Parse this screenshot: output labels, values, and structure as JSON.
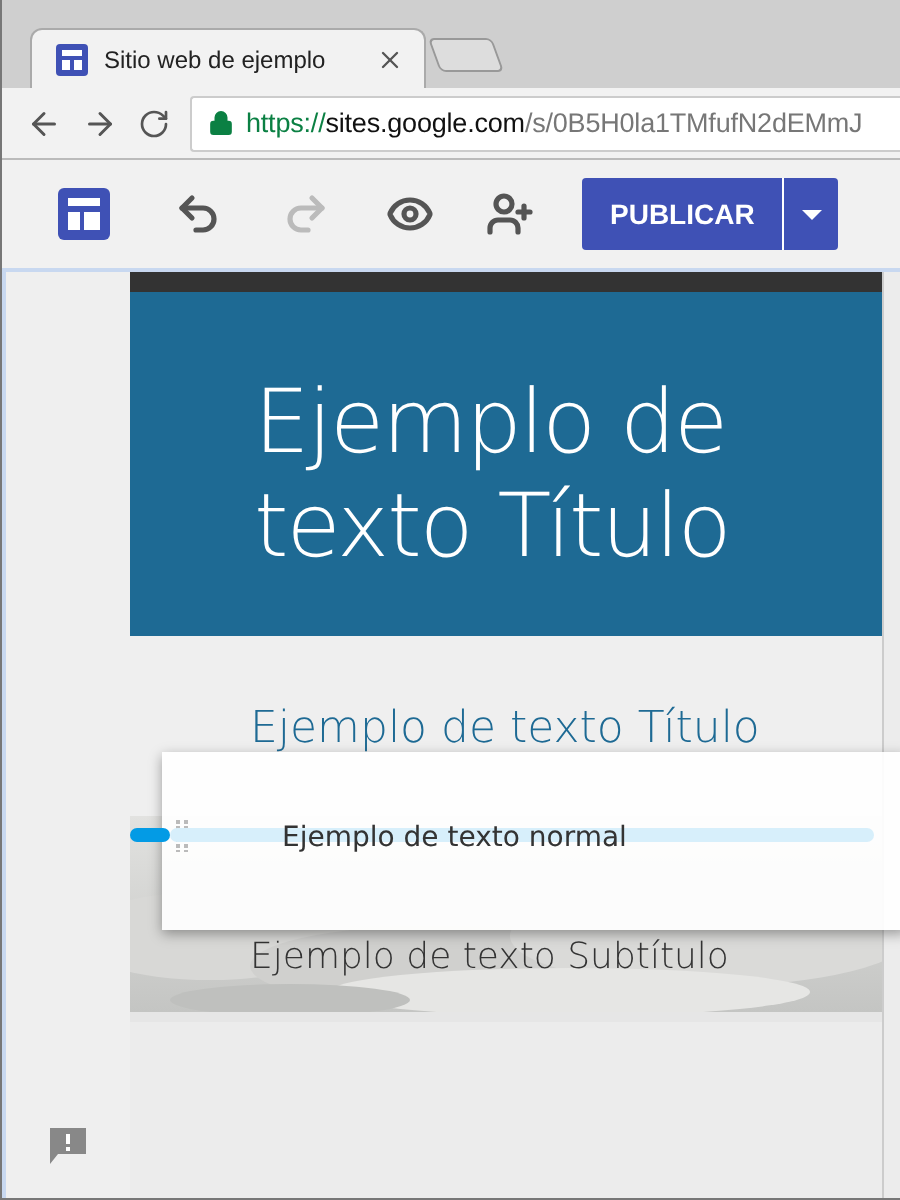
{
  "browser": {
    "tab": {
      "title": "Sitio web de ejemplo",
      "selected": true
    },
    "address": {
      "scheme": "https://",
      "host": "sites.google.com",
      "path": "/s/0B5H0la1TMfufN2dEMmJ",
      "secure": true
    }
  },
  "toolbar": {
    "tools": [
      {
        "kind": "undo",
        "disabled": false
      },
      {
        "kind": "redo",
        "disabled": true
      },
      {
        "kind": "preview",
        "disabled": false
      },
      {
        "kind": "share",
        "disabled": false
      }
    ],
    "publish": {
      "label": "PUBLICAR"
    }
  },
  "page": {
    "header": {
      "title": "Ejemplo de texto Título"
    },
    "section": {
      "blocks": [
        {
          "kind": "title",
          "text": "Ejemplo de texto Título"
        },
        {
          "kind": "subtitle",
          "text": "Ejemplo de texto Subtítulo"
        }
      ],
      "dragged": {
        "text": "Ejemplo de texto normal"
      }
    }
  }
}
